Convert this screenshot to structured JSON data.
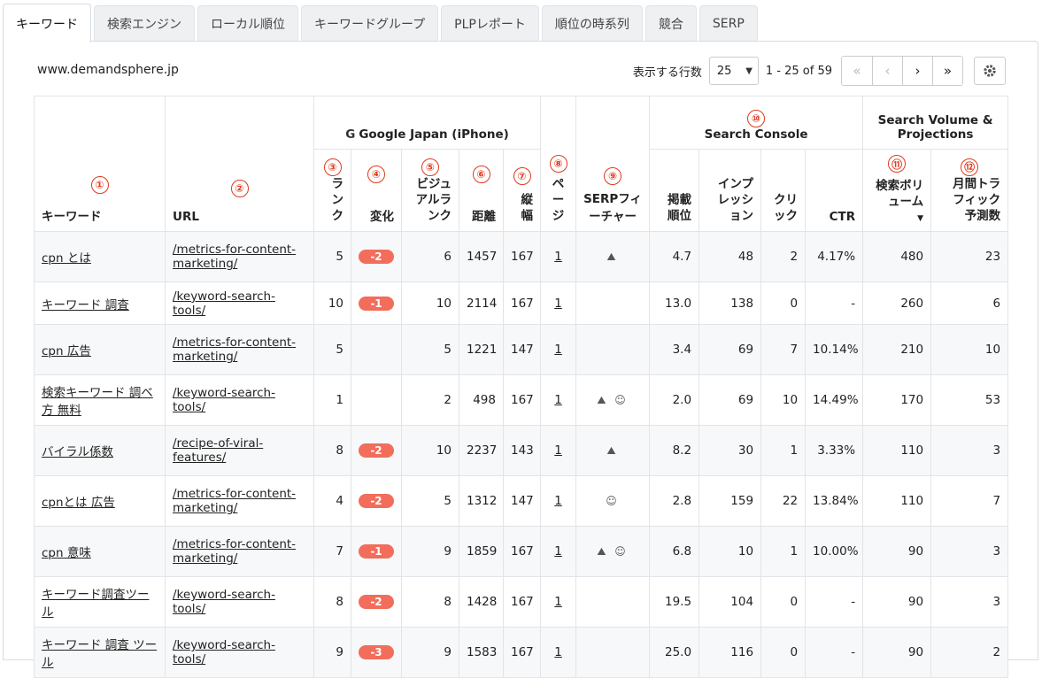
{
  "tabs": [
    {
      "label": "キーワード",
      "active": true
    },
    {
      "label": "検索エンジン",
      "active": false
    },
    {
      "label": "ローカル順位",
      "active": false
    },
    {
      "label": "キーワードグループ",
      "active": false
    },
    {
      "label": "PLPレポート",
      "active": false
    },
    {
      "label": "順位の時系列",
      "active": false
    },
    {
      "label": "競合",
      "active": false
    },
    {
      "label": "SERP",
      "active": false
    }
  ],
  "domain": "www.demandsphere.jp",
  "pager": {
    "rows_label": "表示する行数",
    "rows_value": "25",
    "range": "1 - 25 of 59",
    "first_icon": "«",
    "prev_icon": "‹",
    "next_icon": "›",
    "last_icon": "»",
    "settings_icon": "gear-icon"
  },
  "groups": {
    "google": "Google Japan (iPhone)",
    "google_icon": "G",
    "search_console": "Search Console",
    "search_volume": "Search Volume & Projections"
  },
  "markers": [
    "①",
    "②",
    "③",
    "④",
    "⑤",
    "⑥",
    "⑦",
    "⑧",
    "⑨",
    "⑩",
    "⑪",
    "⑫"
  ],
  "columns": {
    "keyword": "キーワード",
    "url": "URL",
    "rank": "ランク",
    "change": "変化",
    "visual_rank": "ビジュアルランク",
    "distance": "距離",
    "width": "縦幅",
    "page": "ページ",
    "serp_feature": "SERPフィーチャー",
    "position": "掲載順位",
    "impressions": "インプレッション",
    "clicks": "クリック",
    "ctr": "CTR",
    "volume": "検索ボリューム",
    "volume_sort_icon": "▼",
    "traffic": "月間トラフィック予測数"
  },
  "rows": [
    {
      "keyword": "cpn とは",
      "url": "/metrics-for-content-marketing/",
      "rank": "5",
      "change": "-2",
      "vrank": "6",
      "dist": "1457",
      "height": "167",
      "page": "1",
      "features": "⛰",
      "pos": "4.7",
      "impr": "48",
      "clicks": "2",
      "ctr": "4.17%",
      "vol": "480",
      "traffic": "23"
    },
    {
      "keyword": "キーワード 調査",
      "url": "/keyword-search-tools/",
      "rank": "10",
      "change": "-1",
      "vrank": "10",
      "dist": "2114",
      "height": "167",
      "page": "1",
      "features": "",
      "pos": "13.0",
      "impr": "138",
      "clicks": "0",
      "ctr": "-",
      "vol": "260",
      "traffic": "6"
    },
    {
      "keyword": "cpn 広告",
      "url": "/metrics-for-content-marketing/",
      "rank": "5",
      "change": "",
      "vrank": "5",
      "dist": "1221",
      "height": "147",
      "page": "1",
      "features": "",
      "pos": "3.4",
      "impr": "69",
      "clicks": "7",
      "ctr": "10.14%",
      "vol": "210",
      "traffic": "10"
    },
    {
      "keyword": "検索キーワード 調べ方 無料",
      "url": "/keyword-search-tools/",
      "rank": "1",
      "change": "",
      "vrank": "2",
      "dist": "498",
      "height": "167",
      "page": "1",
      "features": "⛰ ☺",
      "pos": "2.0",
      "impr": "69",
      "clicks": "10",
      "ctr": "14.49%",
      "vol": "170",
      "traffic": "53"
    },
    {
      "keyword": "バイラル係数",
      "url": "/recipe-of-viral-features/",
      "rank": "8",
      "change": "-2",
      "vrank": "10",
      "dist": "2237",
      "height": "143",
      "page": "1",
      "features": "⛰",
      "pos": "8.2",
      "impr": "30",
      "clicks": "1",
      "ctr": "3.33%",
      "vol": "110",
      "traffic": "3"
    },
    {
      "keyword": "cpnとは 広告",
      "url": "/metrics-for-content-marketing/",
      "rank": "4",
      "change": "-2",
      "vrank": "5",
      "dist": "1312",
      "height": "147",
      "page": "1",
      "features": "☺",
      "pos": "2.8",
      "impr": "159",
      "clicks": "22",
      "ctr": "13.84%",
      "vol": "110",
      "traffic": "7"
    },
    {
      "keyword": "cpn 意味",
      "url": "/metrics-for-content-marketing/",
      "rank": "7",
      "change": "-1",
      "vrank": "9",
      "dist": "1859",
      "height": "167",
      "page": "1",
      "features": "⛰ ☺",
      "pos": "6.8",
      "impr": "10",
      "clicks": "1",
      "ctr": "10.00%",
      "vol": "90",
      "traffic": "3"
    },
    {
      "keyword": "キーワード調査ツール",
      "url": "/keyword-search-tools/",
      "rank": "8",
      "change": "-2",
      "vrank": "8",
      "dist": "1428",
      "height": "167",
      "page": "1",
      "features": "",
      "pos": "19.5",
      "impr": "104",
      "clicks": "0",
      "ctr": "-",
      "vol": "90",
      "traffic": "3"
    },
    {
      "keyword": "キーワード 調査 ツール",
      "url": "/keyword-search-tools/",
      "rank": "9",
      "change": "-3",
      "vrank": "9",
      "dist": "1583",
      "height": "167",
      "page": "1",
      "features": "",
      "pos": "25.0",
      "impr": "116",
      "clicks": "0",
      "ctr": "-",
      "vol": "90",
      "traffic": "2"
    }
  ]
}
